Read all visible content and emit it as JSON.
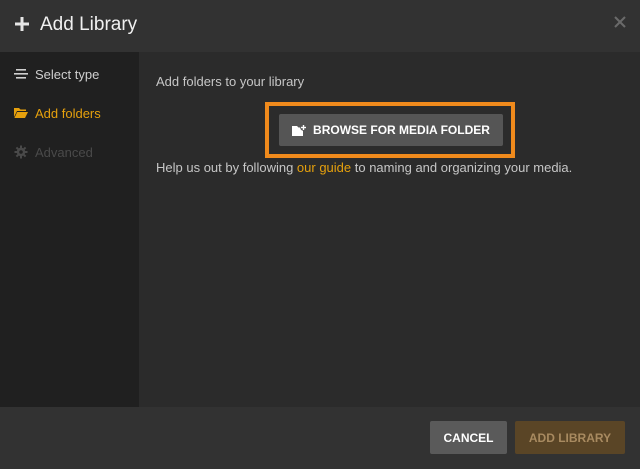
{
  "header": {
    "title": "Add Library",
    "icon": "plus-icon",
    "close_icon": "close-icon"
  },
  "sidebar": {
    "items": [
      {
        "label": "Select type",
        "icon": "list-icon",
        "state": "normal"
      },
      {
        "label": "Add folders",
        "icon": "folder-open-icon",
        "state": "active"
      },
      {
        "label": "Advanced",
        "icon": "gear-icon",
        "state": "disabled"
      }
    ]
  },
  "main": {
    "instruction": "Add folders to your library",
    "browse_button_label": "BROWSE FOR MEDIA FOLDER",
    "browse_icon": "folder-plus-icon",
    "help_prefix": "Help us out by following ",
    "help_link": "our guide",
    "help_suffix": " to naming and organizing your media."
  },
  "footer": {
    "cancel_label": "CANCEL",
    "add_label": "ADD LIBRARY",
    "add_disabled": true
  },
  "colors": {
    "accent": "#e5a00d",
    "highlight": "#f08a1c",
    "header_bg": "#323232",
    "sidebar_bg": "#202020",
    "main_bg": "#2b2b2b"
  }
}
